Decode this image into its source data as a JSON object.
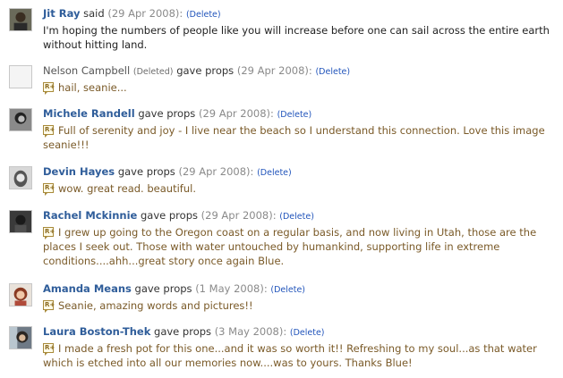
{
  "comments": [
    {
      "author": "Jit Ray",
      "deleted_label": "",
      "action": "said",
      "date": "(29 Apr 2008):",
      "delete_label": "(Delete)",
      "text": "I'm hoping the numbers of people like you will increase before one can sail across the entire earth without hitting land.",
      "type": "said",
      "avatar": "avatar-dark-man-icon"
    },
    {
      "author": "Nelson Campbell",
      "deleted_label": "(Deleted)",
      "action": "gave props",
      "date": "(29 Apr 2008):",
      "delete_label": "(Delete)",
      "text": "hail, seanie...",
      "type": "props",
      "avatar": "avatar-placeholder-icon"
    },
    {
      "author": "Michele Randell",
      "deleted_label": "",
      "action": "gave props",
      "date": "(29 Apr 2008):",
      "delete_label": "(Delete)",
      "text": "Full of serenity and joy - I live near the beach so I understand this connection. Love this image seanie!!!",
      "type": "props",
      "avatar": "avatar-bw-woman-icon"
    },
    {
      "author": "Devin Hayes",
      "deleted_label": "",
      "action": "gave props",
      "date": "(29 Apr 2008):",
      "delete_label": "(Delete)",
      "text": "wow. great read. beautiful.",
      "type": "props",
      "avatar": "avatar-bw-face-icon"
    },
    {
      "author": "Rachel Mckinnie",
      "deleted_label": "",
      "action": "gave props",
      "date": "(29 Apr 2008):",
      "delete_label": "(Delete)",
      "text": "I grew up going to the Oregon coast on a regular basis, and now living in Utah, those are the places I seek out. Those with water untouched by humankind, supporting life in extreme conditions....ahh...great story once again Blue.",
      "type": "props",
      "avatar": "avatar-dark-woman-icon"
    },
    {
      "author": "Amanda Means",
      "deleted_label": "",
      "action": "gave props",
      "date": "(1 May 2008):",
      "delete_label": "(Delete)",
      "text": "Seanie, amazing words and pictures!!",
      "type": "props",
      "avatar": "avatar-redhead-woman-icon"
    },
    {
      "author": "Laura Boston-Thek",
      "deleted_label": "",
      "action": "gave props",
      "date": "(3 May 2008):",
      "delete_label": "(Delete)",
      "text": "I made a fresh pot for this one...and it was so worth it!! Refreshing to my soul...as that water which is etched into all our memories now....was to yours. Thanks Blue!",
      "type": "props",
      "avatar": "avatar-woman-window-icon"
    }
  ],
  "props_icon_label": "R+",
  "colors": {
    "author_link": "#2f5d9a",
    "date": "#8a8a8a",
    "delete_link": "#2255bb",
    "props_text": "#7a5a28"
  }
}
